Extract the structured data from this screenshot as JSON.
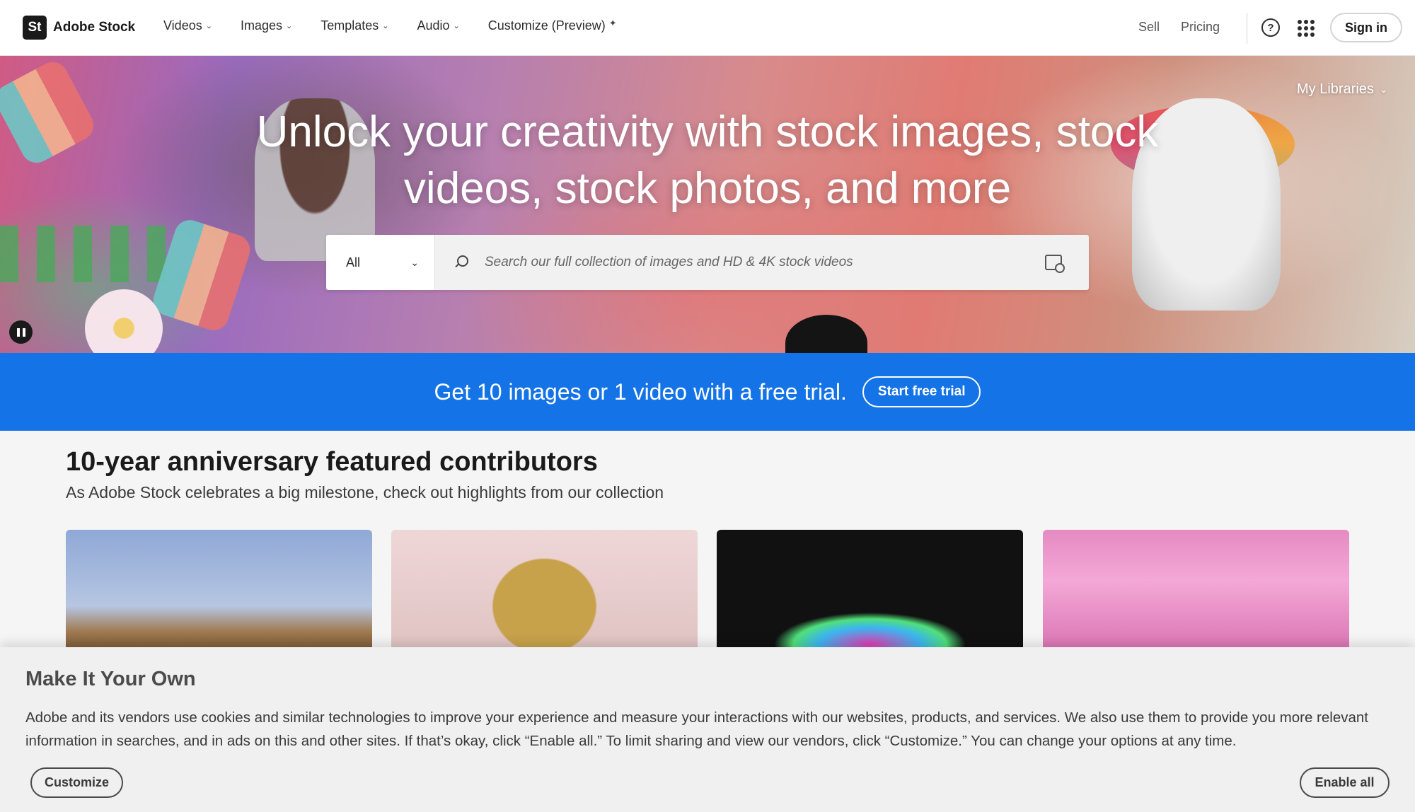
{
  "brand": {
    "logo_text": "St",
    "name": "Adobe Stock"
  },
  "nav": {
    "items": [
      {
        "label": "Videos",
        "icon": "chevron-down-icon"
      },
      {
        "label": "Images",
        "icon": "chevron-down-icon"
      },
      {
        "label": "Templates",
        "icon": "chevron-down-icon"
      },
      {
        "label": "Audio",
        "icon": "chevron-down-icon"
      },
      {
        "label": "Customize (Preview)",
        "icon": "sparkle-icon"
      }
    ],
    "sell": "Sell",
    "pricing": "Pricing",
    "help_icon": "help-icon",
    "apps_icon": "apps-grid-icon",
    "sign_in": "Sign in"
  },
  "hero": {
    "title": "Unlock your creativity with stock images, stock videos, stock photos, and more",
    "my_libraries": "My Libraries",
    "search": {
      "type_selected": "All",
      "placeholder": "Search our full collection of images and HD & 4K stock videos"
    }
  },
  "promo": {
    "text": "Get 10 images or 1 video with a free trial.",
    "button": "Start free trial"
  },
  "featured": {
    "title": "10-year anniversary featured contributors",
    "subtitle": "As Adobe Stock celebrates a big milestone, check out highlights from our collection"
  },
  "cookie": {
    "title": "Make It Your Own",
    "body": "Adobe and its vendors use cookies and similar technologies to improve your experience and measure your interactions with our websites, products, and services. We also use them to provide you more relevant information in searches, and in ads on this and other sites. If that’s okay, click “Enable all.” To limit sharing and view our vendors, click “Customize.” You can change your options at any time.",
    "customize_button": "Customize",
    "enable_button": "Enable all"
  },
  "colors": {
    "promo_blue": "#1473e6",
    "text_dark": "#2c2c2c"
  }
}
